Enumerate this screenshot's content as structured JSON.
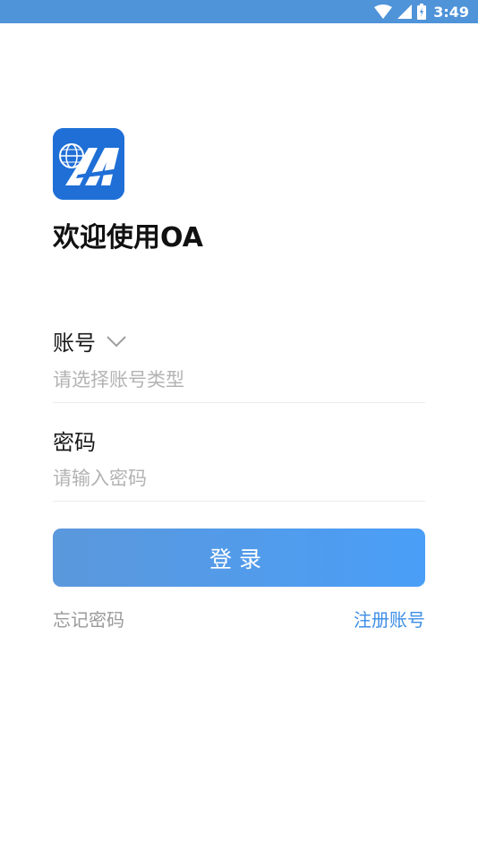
{
  "status_bar": {
    "time": "3:49",
    "background": "#4f93d9",
    "icons": [
      "wifi-icon",
      "cellular-signal-icon",
      "battery-icon"
    ]
  },
  "app": {
    "logo_icon": "oa-logo-icon",
    "welcome_title": "欢迎使用OA"
  },
  "account": {
    "label": "账号",
    "dropdown_icon": "chevron-down-icon",
    "placeholder": "请选择账号类型",
    "value": ""
  },
  "password": {
    "label": "密码",
    "placeholder": "请输入密码",
    "value": ""
  },
  "login_button": {
    "label": "登录",
    "color_start": "#5b98dc",
    "color_end": "#4a9ef7"
  },
  "links": {
    "forgot_password": "忘记密码",
    "register": "注册账号",
    "register_color": "#3d8ee6"
  }
}
